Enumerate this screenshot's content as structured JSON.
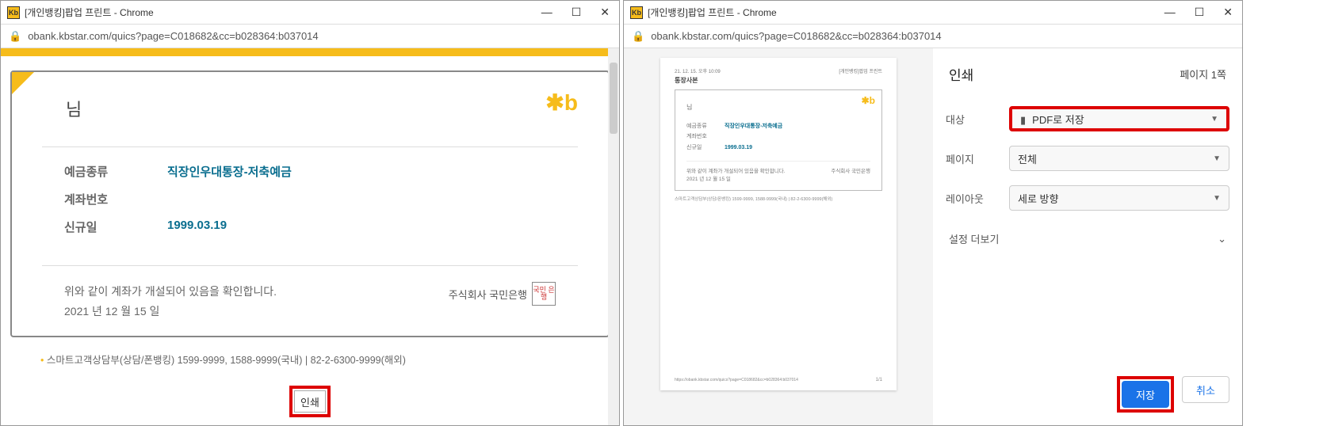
{
  "left": {
    "title": "[개인뱅킹]팝업 프린트 - Chrome",
    "url": "obank.kbstar.com/quics?page=C018682&cc=b028364:b037014",
    "greet": "님",
    "rows": {
      "type_lbl": "예금종류",
      "type_val": "직장인우대통장-저축예금",
      "acct_lbl": "계좌번호",
      "date_lbl": "신규일",
      "date_val": "1999.03.19"
    },
    "confirm1": "위와 같이 계좌가 개설되어 있음을 확인합니다.",
    "confirm2": "2021 년 12 월 15 일",
    "bankname": "주식회사 국민은행",
    "seal": "국민\n은행",
    "footer": "스마트고객상담부(상담/폰뱅킹) 1599-9999, 1588-9999(국내) | 82-2-6300-9999(해외)",
    "printbtn": "인쇄"
  },
  "right": {
    "title": "[개인뱅킹]팝업 프린트 - Chrome",
    "url": "obank.kbstar.com/quics?page=C018682&cc=b028364:b037014",
    "preview": {
      "timestamp": "21. 12. 15. 오후 10:09",
      "header_r": "[개인뱅킹]팝업 프린트",
      "doctitle": "통장사본",
      "greet": "님",
      "r1l": "예금종류",
      "r1v": "직장인우대통장-저축예금",
      "r2l": "계좌번호",
      "r3l": "신규일",
      "r3v": "1999.03.19",
      "conf1": "위와 같이 계좌가 개설되어 있음을 확인합니다.",
      "conf2": "2021 년 12 월 15 일",
      "bank": "주식회사 국민은행",
      "foot": "스마트고객상담부(상담/폰뱅킹) 1599-9999, 1588-9999(국내) | 82-2-6300-9999(해외)",
      "prevurl": "https://obank.kbstar.com/quics?page=C018682&cc=b028364:b037014",
      "pagenum": "1/1"
    },
    "panel": {
      "title": "인쇄",
      "pagecount": "페이지 1쪽",
      "dest_lbl": "대상",
      "dest_val": "PDF로 저장",
      "pages_lbl": "페이지",
      "pages_val": "전체",
      "layout_lbl": "레이아웃",
      "layout_val": "세로 방향",
      "more": "설정 더보기",
      "save": "저장",
      "cancel": "취소"
    }
  }
}
